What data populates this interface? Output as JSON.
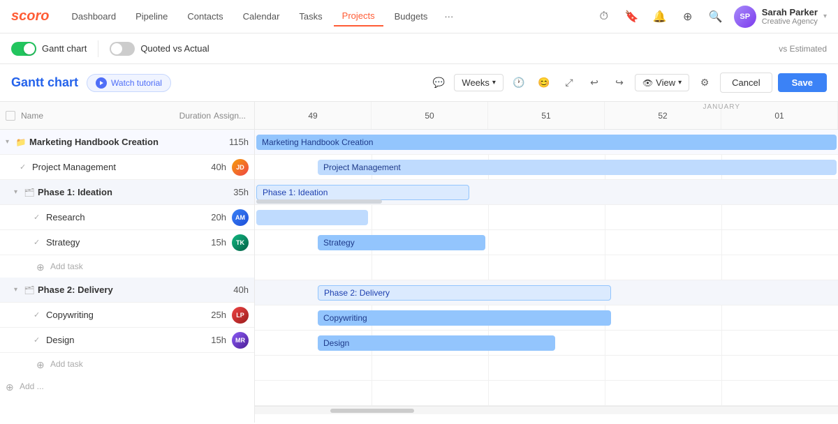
{
  "logo": {
    "text": "scoro"
  },
  "nav": {
    "items": [
      {
        "label": "Dashboard",
        "active": false
      },
      {
        "label": "Pipeline",
        "active": false
      },
      {
        "label": "Contacts",
        "active": false
      },
      {
        "label": "Calendar",
        "active": false
      },
      {
        "label": "Tasks",
        "active": false
      },
      {
        "label": "Projects",
        "active": true
      },
      {
        "label": "Budgets",
        "active": false
      }
    ],
    "more_label": "···"
  },
  "user": {
    "name": "Sarah Parker",
    "company": "Creative Agency",
    "avatar_initials": "SP"
  },
  "toolbar": {
    "gantt_chart_label": "Gantt chart",
    "quoted_vs_actual_label": "Quoted vs Actual",
    "vs_estimated": "vs Estimated"
  },
  "gantt_header": {
    "title": "Gantt chart",
    "watch_tutorial": "Watch tutorial",
    "weeks_label": "Weeks",
    "view_label": "View",
    "cancel_label": "Cancel",
    "save_label": "Save"
  },
  "columns": {
    "name": "Name",
    "duration": "Duration",
    "assigned": "Assign..."
  },
  "weeks": [
    {
      "num": "49",
      "month": ""
    },
    {
      "num": "50",
      "month": ""
    },
    {
      "num": "51",
      "month": ""
    },
    {
      "num": "52",
      "month": ""
    },
    {
      "num": "01",
      "month": ""
    }
  ],
  "month_label": "JANUARY",
  "tasks": [
    {
      "id": "marketing-handbook",
      "level": 0,
      "type": "group",
      "name": "Marketing Handbook Creation",
      "duration": "115h",
      "has_avatar": false,
      "avatar_color": "",
      "avatar_initials": "",
      "collapsible": true,
      "icon": "folder"
    },
    {
      "id": "project-management",
      "level": 1,
      "type": "task",
      "name": "Project Management",
      "duration": "40h",
      "has_avatar": true,
      "avatar_color": "#f59e0b",
      "avatar_initials": "JD",
      "collapsible": false,
      "icon": "check"
    },
    {
      "id": "phase1",
      "level": 1,
      "type": "phase",
      "name": "Phase 1: Ideation",
      "duration": "35h",
      "has_avatar": false,
      "avatar_color": "",
      "avatar_initials": "",
      "collapsible": true,
      "icon": "folder"
    },
    {
      "id": "research",
      "level": 2,
      "type": "task",
      "name": "Research",
      "duration": "20h",
      "has_avatar": true,
      "avatar_color": "#3b82f6",
      "avatar_initials": "AM",
      "collapsible": false,
      "icon": "check"
    },
    {
      "id": "strategy",
      "level": 2,
      "type": "task",
      "name": "Strategy",
      "duration": "15h",
      "has_avatar": true,
      "avatar_color": "#10b981",
      "avatar_initials": "TK",
      "collapsible": false,
      "icon": "check"
    },
    {
      "id": "add-task-1",
      "level": 2,
      "type": "add",
      "name": "Add task",
      "duration": "",
      "has_avatar": false
    },
    {
      "id": "phase2",
      "level": 1,
      "type": "phase",
      "name": "Phase 2: Delivery",
      "duration": "40h",
      "has_avatar": false,
      "avatar_color": "",
      "avatar_initials": "",
      "collapsible": true,
      "icon": "folder"
    },
    {
      "id": "copywriting",
      "level": 2,
      "type": "task",
      "name": "Copywriting",
      "duration": "25h",
      "has_avatar": true,
      "avatar_color": "#ef4444",
      "avatar_initials": "LP",
      "collapsible": false,
      "icon": "check"
    },
    {
      "id": "design",
      "level": 2,
      "type": "task",
      "name": "Design",
      "duration": "15h",
      "has_avatar": true,
      "avatar_color": "#8b5cf6",
      "avatar_initials": "MR",
      "collapsible": false,
      "icon": "check"
    },
    {
      "id": "add-task-2",
      "level": 2,
      "type": "add",
      "name": "Add task",
      "duration": "",
      "has_avatar": false
    },
    {
      "id": "add-group",
      "level": 0,
      "type": "add-group",
      "name": "Add ...",
      "duration": "",
      "has_avatar": false
    }
  ],
  "gantt_bars": {
    "marketing_handbook": {
      "label": "Marketing Handbook Creation",
      "left": "0%",
      "width": "100%",
      "color": "blue"
    },
    "project_management": {
      "label": "Project Management",
      "left": "27%",
      "width": "73%",
      "color": "blue"
    },
    "phase1_ideation": {
      "label": "Phase 1: Ideation",
      "left": "0%",
      "width": "38%",
      "color": "phase"
    },
    "phase1_gray": {
      "left": "0%",
      "width": "27%",
      "color": "gray"
    },
    "research": {
      "label": "",
      "left": "0%",
      "width": "19%",
      "color": "light"
    },
    "strategy": {
      "label": "Strategy",
      "left": "21%",
      "width": "27%",
      "color": "blue"
    },
    "phase2_delivery": {
      "label": "Phase 2: Delivery",
      "left": "21%",
      "width": "48%",
      "color": "phase"
    },
    "copywriting": {
      "label": "Copywriting",
      "left": "21%",
      "width": "48%",
      "color": "blue"
    },
    "design": {
      "label": "Design",
      "left": "21%",
      "width": "38%",
      "color": "blue"
    }
  }
}
